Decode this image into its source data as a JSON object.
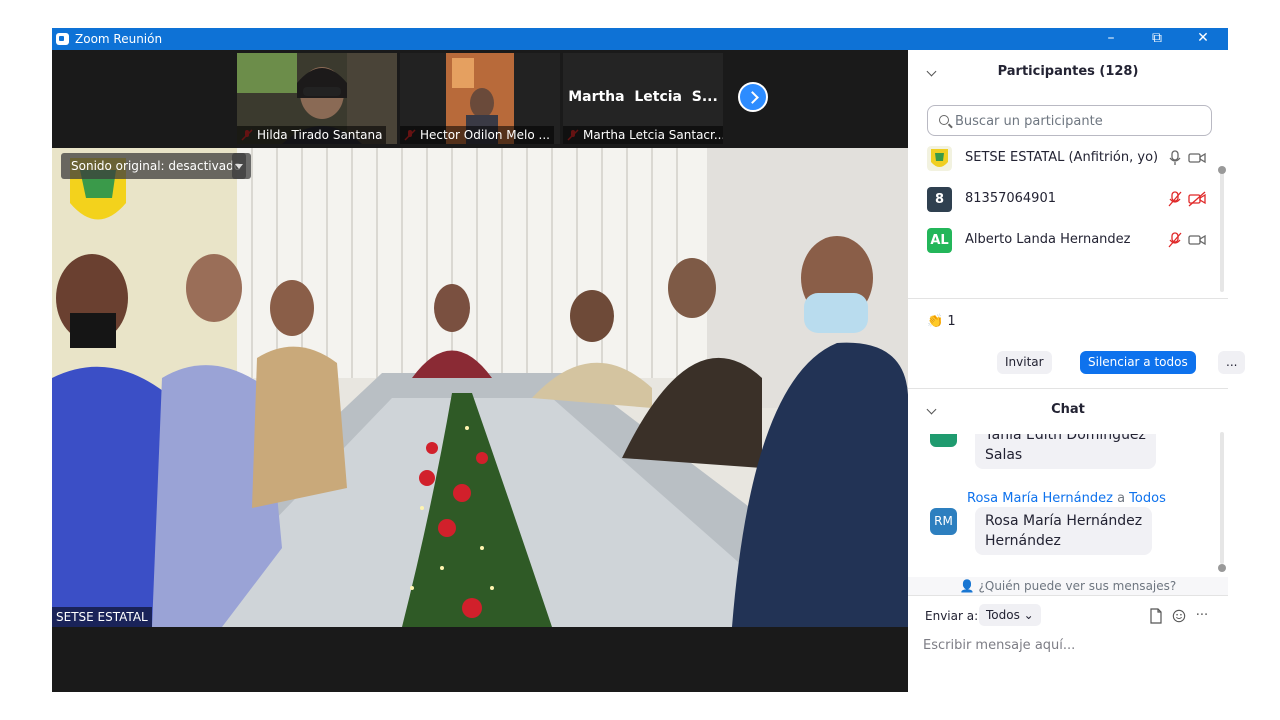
{
  "window": {
    "title": "Zoom Reunión",
    "controls": {
      "minimize": "–",
      "restore": "⧉",
      "close": "✕"
    }
  },
  "thumbnails": [
    {
      "name": "Hilda Tirado Santana",
      "muted": true
    },
    {
      "name": "Hector Odilon Melo ...",
      "muted": true
    },
    {
      "name": "Martha Letcia Santacr...",
      "muted": true,
      "display_name": "Martha  Letcia  S..."
    }
  ],
  "main_video": {
    "sound_toggle": "Sonido original: desactivado",
    "label": "SETSE ESTATAL"
  },
  "participants": {
    "header": "Participantes (128)",
    "search_placeholder": "Buscar un participante",
    "list": [
      {
        "initials": "",
        "name": "SETSE ESTATAL (Anfitrión, yo)",
        "avatar_color": "#f2f2e0",
        "mic": "on",
        "cam": "on"
      },
      {
        "initials": "8",
        "name": "81357064901",
        "avatar_color": "#2f4050",
        "mic": "muted",
        "cam": "off"
      },
      {
        "initials": "AL",
        "name": "Alberto Landa Hernandez",
        "avatar_color": "#23b65a",
        "mic": "muted",
        "cam": "on"
      }
    ],
    "reaction": {
      "emoji": "👏",
      "count": "1"
    },
    "buttons": {
      "invite": "Invitar",
      "mute_all": "Silenciar a todos",
      "more": "..."
    }
  },
  "chat": {
    "header": "Chat",
    "messages": [
      {
        "text_line1": "Yania Edith Domínguez",
        "text_line2": "Salas",
        "avatar_color": "#1f9b6f"
      },
      {
        "sender": "Rosa María Hernández",
        "to_word": "a",
        "recipient": "Todos",
        "initials": "RM",
        "avatar_color": "#2d7fbf",
        "text_line1": "Rosa María Hernández",
        "text_line2": "Hernández"
      }
    ],
    "who_can_see": "¿Quién puede ver sus mensajes?",
    "send_to_label": "Enviar a:",
    "send_to_value": "Todos",
    "input_placeholder": "Escribir mensaje aquí..."
  }
}
